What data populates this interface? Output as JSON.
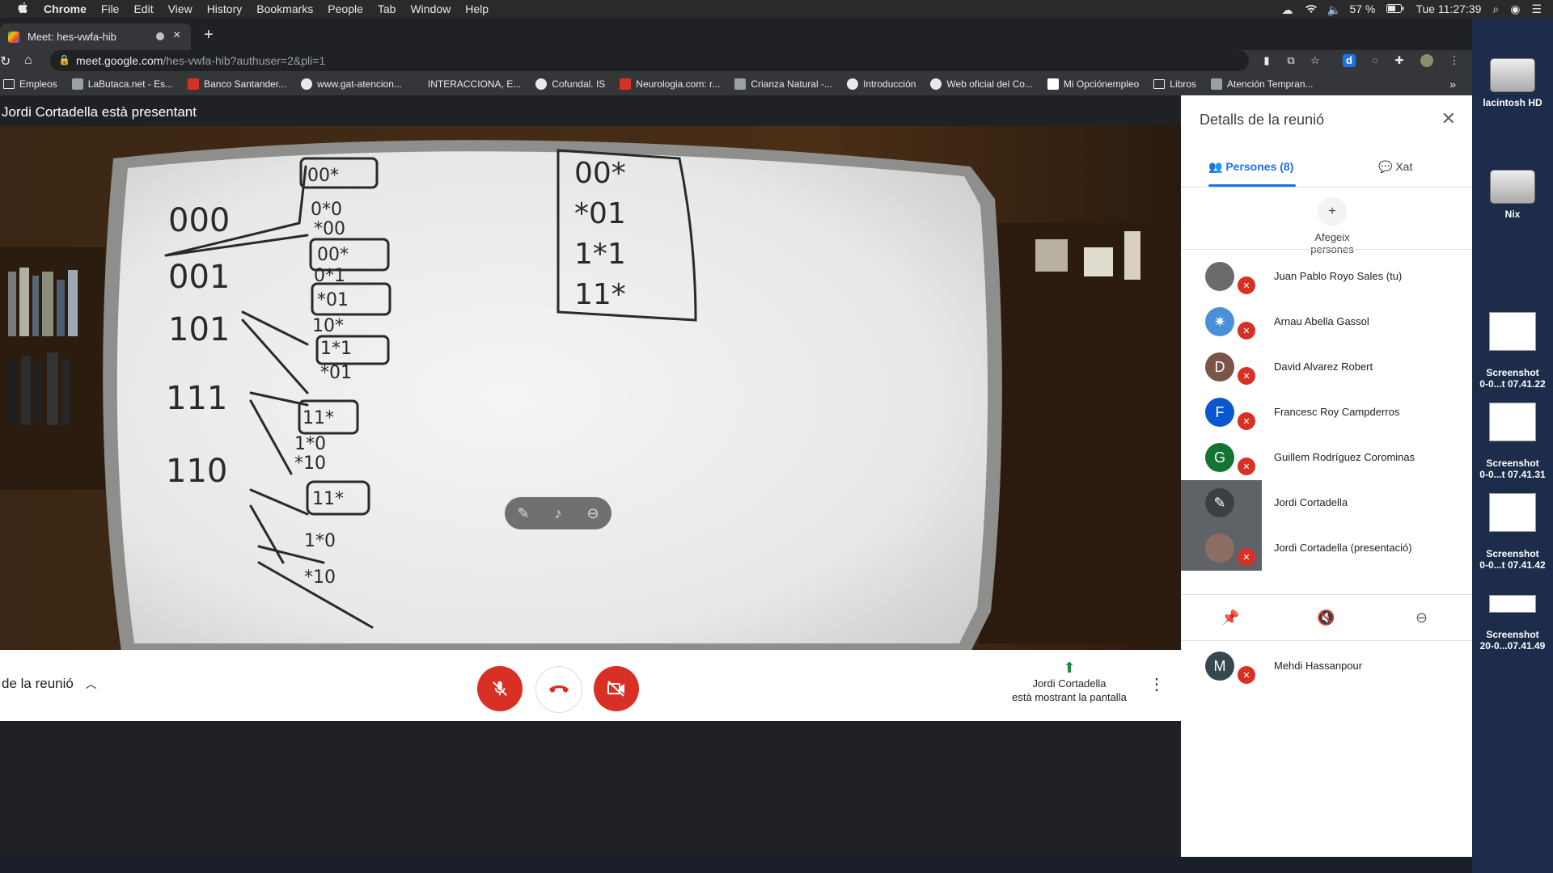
{
  "menubar": {
    "app": "Chrome",
    "menus": [
      "File",
      "Edit",
      "View",
      "History",
      "Bookmarks",
      "People",
      "Tab",
      "Window",
      "Help"
    ],
    "battery": "57 %",
    "clock": "Tue 11:27:39"
  },
  "desktop": {
    "items": [
      {
        "label": "lacintosh HD",
        "kind": "disk"
      },
      {
        "label": "Nix",
        "kind": "disk"
      },
      {
        "label": "Screenshot\n0-0...t 07.41.22",
        "kind": "shot"
      },
      {
        "label": "Screenshot\n0-0...t 07.41.31",
        "kind": "shot"
      },
      {
        "label": "Screenshot\n0-0...t 07.41.42",
        "kind": "shot"
      },
      {
        "label": "Screenshot\n20-0...07.41.49",
        "kind": "shot"
      }
    ]
  },
  "browser": {
    "tab_title": "Meet: hes-vwfa-hib",
    "url_host": "meet.google.com",
    "url_path": "/hes-vwfa-hib?authuser=2&pli=1",
    "bookmarks": [
      "Empleos",
      "LaButaca.net - Es...",
      "Banco Santander...",
      "www.gat-atencion...",
      "INTERACCIONA, E...",
      "Cofundal. IS",
      "Neurologia.com: r...",
      "Crianza Natural -...",
      "Introducción",
      "Web oficial del Co...",
      "Mi Opciónempleo",
      "Libros",
      "Atención Tempran..."
    ],
    "bookmarks_more": "»"
  },
  "meet": {
    "presenter_banner": "Jordi Cortadella està presentant",
    "meeting_details": "de la reunió",
    "presenting_line1": "Jordi Cortadella",
    "presenting_line2": "està mostrant la pantalla",
    "whiteboard": {
      "left_column": [
        "000",
        "001",
        "101",
        "111",
        "110"
      ],
      "branch_groups": [
        "00*",
        "0*0",
        "*00",
        "00*",
        "0*1",
        "*01",
        "10*",
        "1*1",
        "*01",
        "11*",
        "1*0",
        "*10",
        "11*",
        "1*0",
        "*10"
      ],
      "right_box": [
        "00*",
        "*01",
        "1*1",
        "11*"
      ]
    }
  },
  "panel": {
    "title": "Detalls de la reunió",
    "tab_people": "Persones (8)",
    "tab_chat": "Xat",
    "add_people": "Afegeix persones",
    "participants": [
      {
        "name": "Juan Pablo Royo Sales (tu)",
        "initial": "",
        "color": "#6b6b6b",
        "photo": true
      },
      {
        "name": "Arnau Abella Gassol",
        "initial": "",
        "color": "#4a90d9",
        "photo": true
      },
      {
        "name": "David Alvarez Robert",
        "initial": "D",
        "color": "#795548"
      },
      {
        "name": "Francesc Roy Campderros",
        "initial": "F",
        "color": "#0b57d0"
      },
      {
        "name": "Guillem Rodríguez Corominas",
        "initial": "G",
        "color": "#137333"
      },
      {
        "name": "Jordi Cortadella",
        "initial": "",
        "color": "#3c4043",
        "highlight": true
      },
      {
        "name": "Jordi Cortadella (presentació)",
        "initial": "",
        "color": "#8d6e63",
        "highlight": true
      },
      {
        "name": "Mehdi Hassanpour",
        "initial": "M",
        "color": "#37474f"
      }
    ]
  },
  "colors": {
    "accent": "#1a73e8",
    "danger": "#d93025",
    "present": "#1e8e3e"
  }
}
